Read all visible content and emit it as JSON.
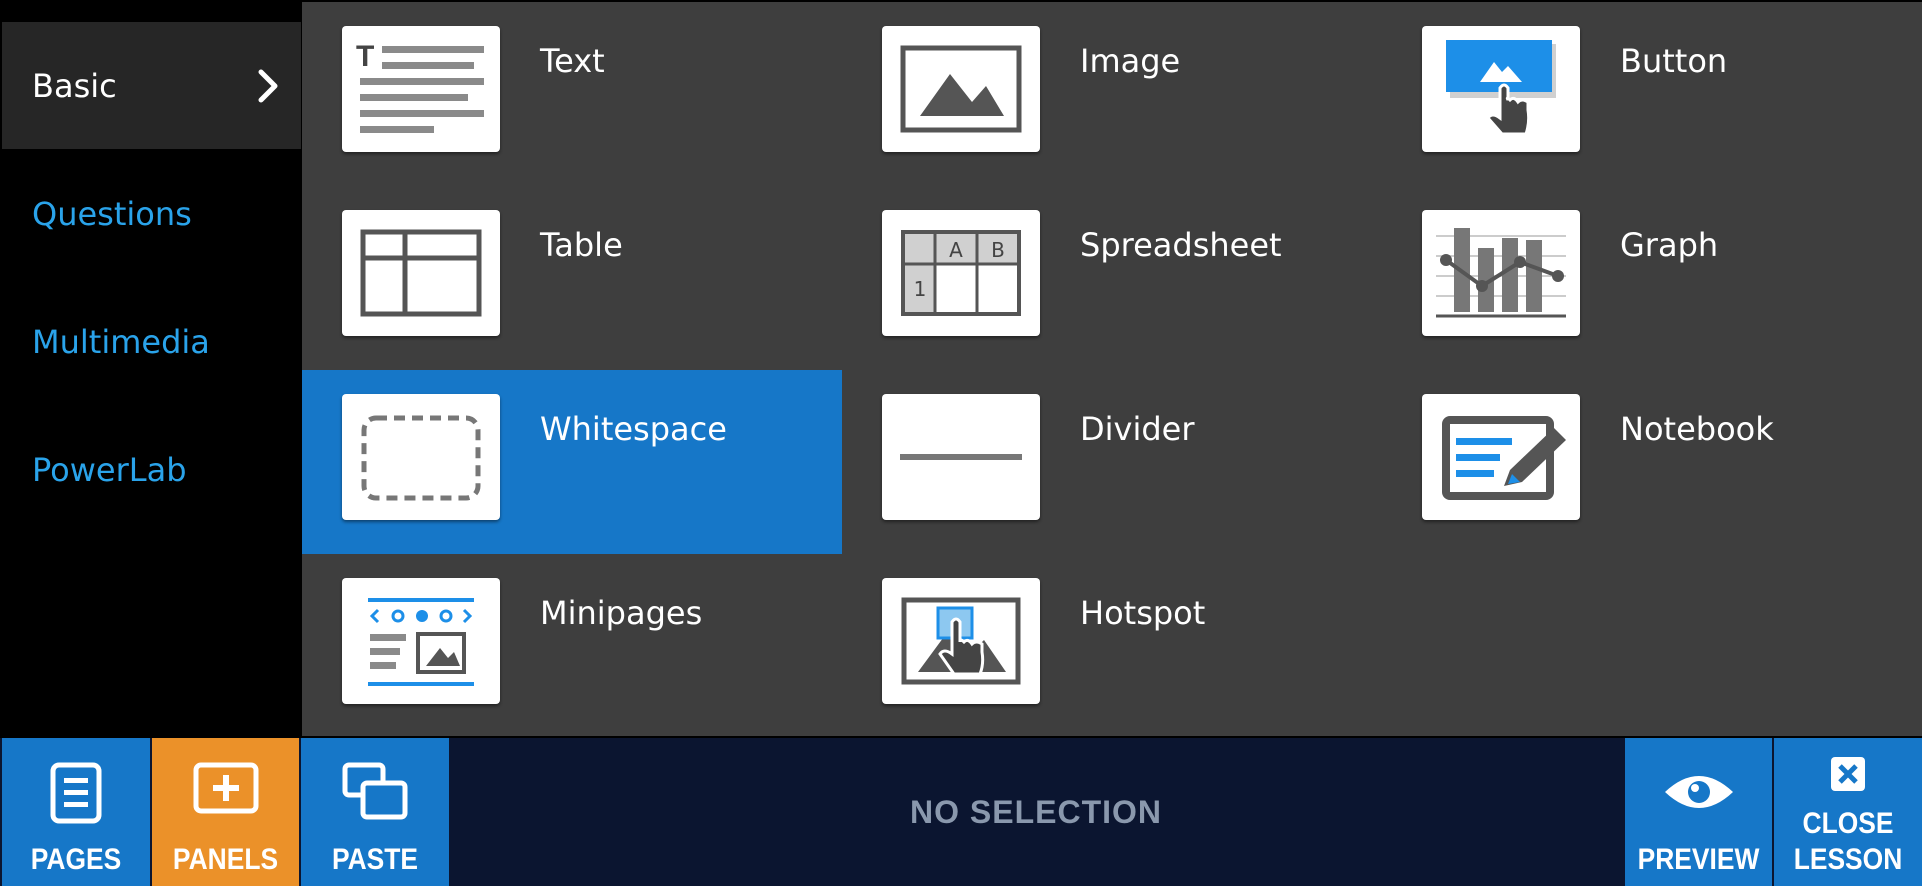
{
  "sidebar": {
    "items": [
      {
        "label": "Basic",
        "active": true
      },
      {
        "label": "Questions"
      },
      {
        "label": "Multimedia"
      },
      {
        "label": "PowerLab"
      }
    ]
  },
  "panels": [
    {
      "label": "Text",
      "icon": "text-icon"
    },
    {
      "label": "Image",
      "icon": "image-icon"
    },
    {
      "label": "Button",
      "icon": "button-icon"
    },
    {
      "label": "Table",
      "icon": "table-icon"
    },
    {
      "label": "Spreadsheet",
      "icon": "spreadsheet-icon",
      "cells": [
        "A",
        "B",
        "1"
      ]
    },
    {
      "label": "Graph",
      "icon": "graph-icon"
    },
    {
      "label": "Whitespace",
      "icon": "whitespace-icon",
      "selected": true
    },
    {
      "label": "Divider",
      "icon": "divider-icon"
    },
    {
      "label": "Notebook",
      "icon": "notebook-icon"
    },
    {
      "label": "Minipages",
      "icon": "minipages-icon"
    },
    {
      "label": "Hotspot",
      "icon": "hotspot-icon"
    }
  ],
  "toolbar": {
    "pages_label": "PAGES",
    "panels_label": "PANELS",
    "paste_label": "PASTE",
    "status": "NO SELECTION",
    "preview_label": "PREVIEW",
    "close_line1": "CLOSE",
    "close_line2": "LESSON"
  },
  "colors": {
    "accent_blue": "#1677c8",
    "link_blue": "#2aa3ea",
    "orange": "#eb9129",
    "panel_bg": "#3e3e3e",
    "toolbar_bg": "#0b1530"
  }
}
